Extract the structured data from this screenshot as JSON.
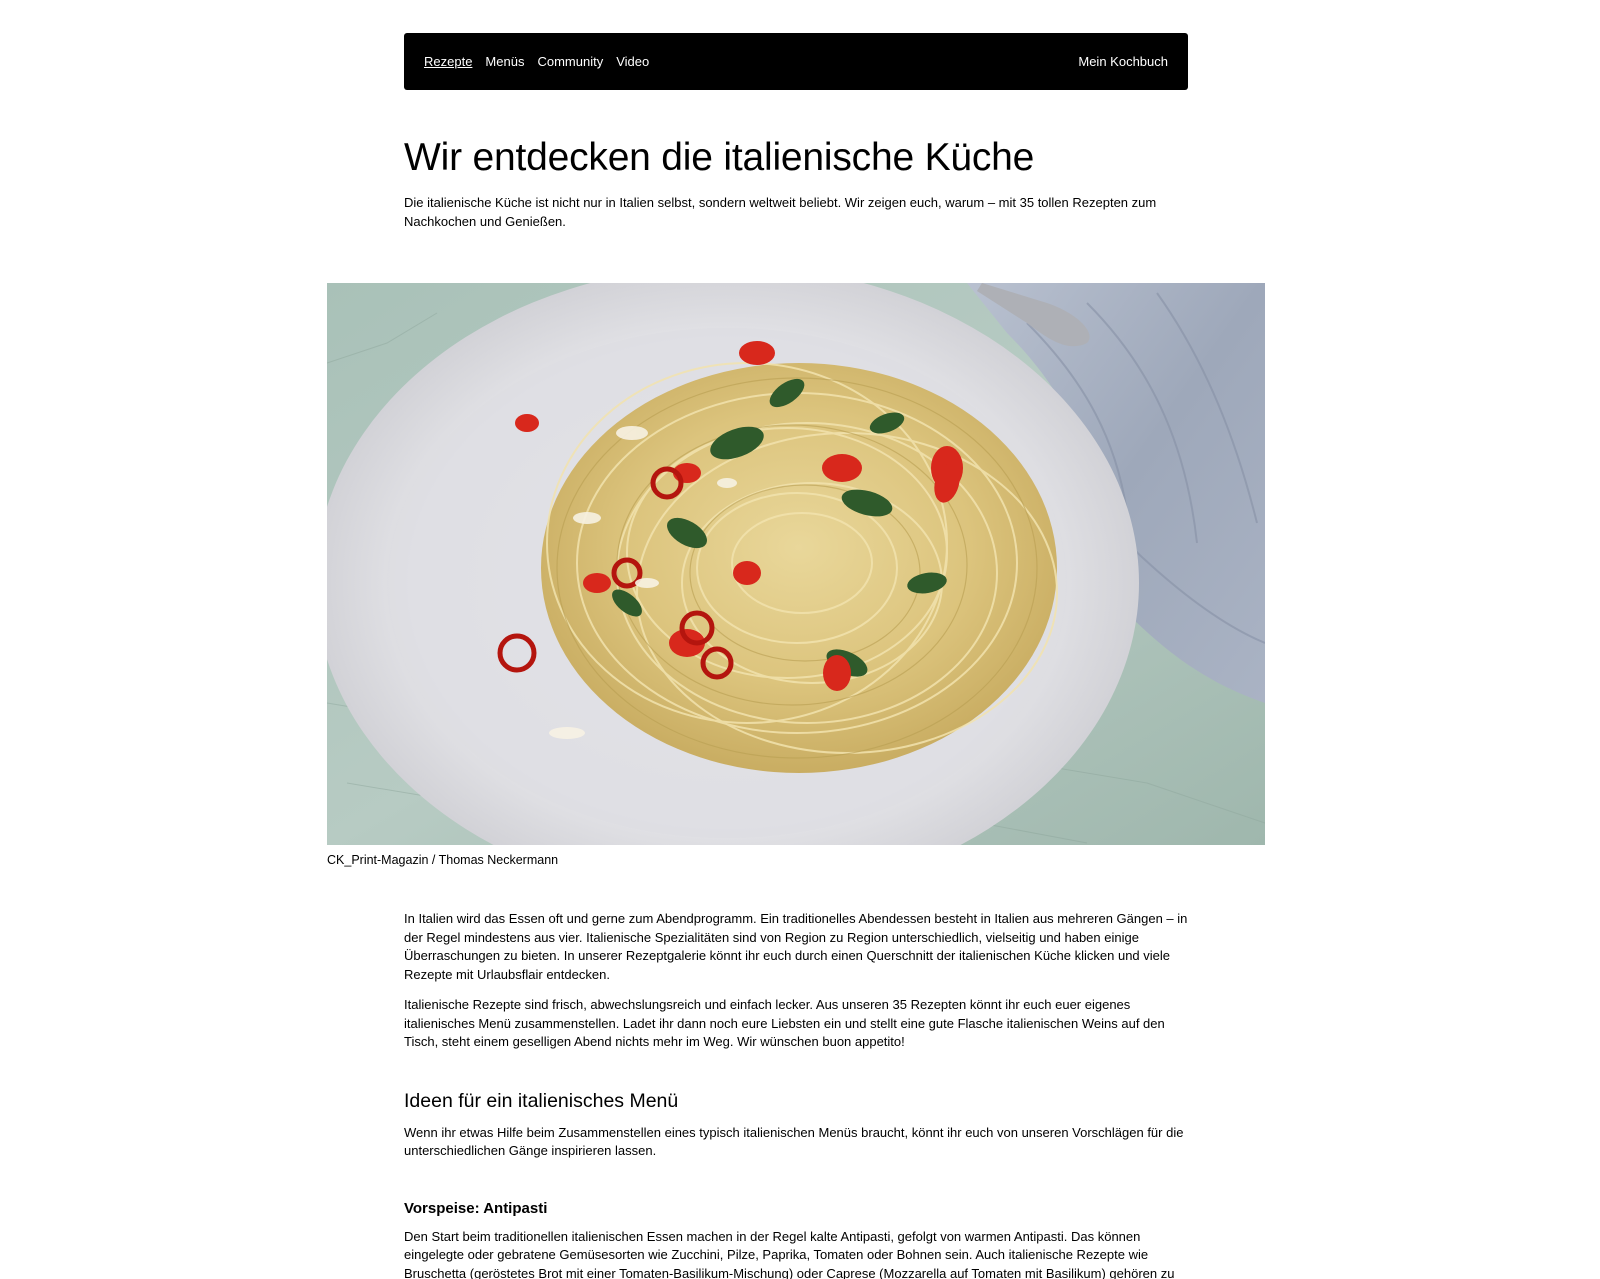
{
  "nav": {
    "items": [
      {
        "label": "Rezepte",
        "active": true
      },
      {
        "label": "Menüs",
        "active": false
      },
      {
        "label": "Community",
        "active": false
      },
      {
        "label": "Video",
        "active": false
      }
    ],
    "right_label": "Mein Kochbuch"
  },
  "header": {
    "title": "Wir entdecken die italienische Küche",
    "lead": "Die italienische Küche ist nicht nur in Italien selbst, sondern weltweit beliebt. Wir zeigen euch, warum – mit 35 tollen Rezepten zum Nachkochen und Genießen."
  },
  "hero": {
    "caption": "CK_Print-Magazin / Thomas Neckermann"
  },
  "article": {
    "paragraphs": [
      "In Italien wird das Essen oft und gerne zum Abendprogramm. Ein traditionelles Abendessen besteht in Italien aus mehreren Gängen – in der Regel mindestens aus vier. Italienische Spezialitäten sind von Region zu Region unterschiedlich, vielseitig und haben einige Überraschungen zu bieten. In unserer Rezeptgalerie könnt ihr euch durch einen Querschnitt der italienischen Küche klicken und viele Rezepte mit Urlaubsflair entdecken.",
      "Italienische Rezepte sind frisch, abwechslungsreich und einfach lecker. Aus unseren 35 Rezepten könnt ihr euch euer eigenes italienisches Menü zusammenstellen. Ladet ihr dann noch eure Liebsten ein und stellt eine gute Flasche italienischen Weins auf den Tisch, steht einem geselligen Abend nichts mehr im Weg. Wir wünschen buon appetito!"
    ],
    "section_heading": "Ideen für ein italienisches Menü",
    "section_text": "Wenn ihr etwas Hilfe beim Zusammenstellen eines typisch italienischen Menüs braucht, könnt ihr euch von unseren Vorschlägen für die unterschiedlichen Gänge inspirieren lassen.",
    "subheading": "Vorspeise: Antipasti",
    "subheading_text": "Den Start beim traditionellen italienischen Essen machen in der Regel kalte Antipasti, gefolgt von warmen Antipasti. Das können eingelegte oder gebratene Gemüsesorten wie Zucchini, Pilze, Paprika, Tomaten oder Bohnen sein. Auch italienische Rezepte wie Bruschetta (geröstetes Brot mit einer Tomaten-Basilikum-Mischung) oder Caprese (Mozzarella auf Tomaten mit Basilikum) gehören zu den beliebtesten Antipasti."
  },
  "colors": {
    "nav_background": "#000000",
    "nav_text": "#ffffff",
    "page_background": "#ffffff",
    "text": "#000000"
  }
}
